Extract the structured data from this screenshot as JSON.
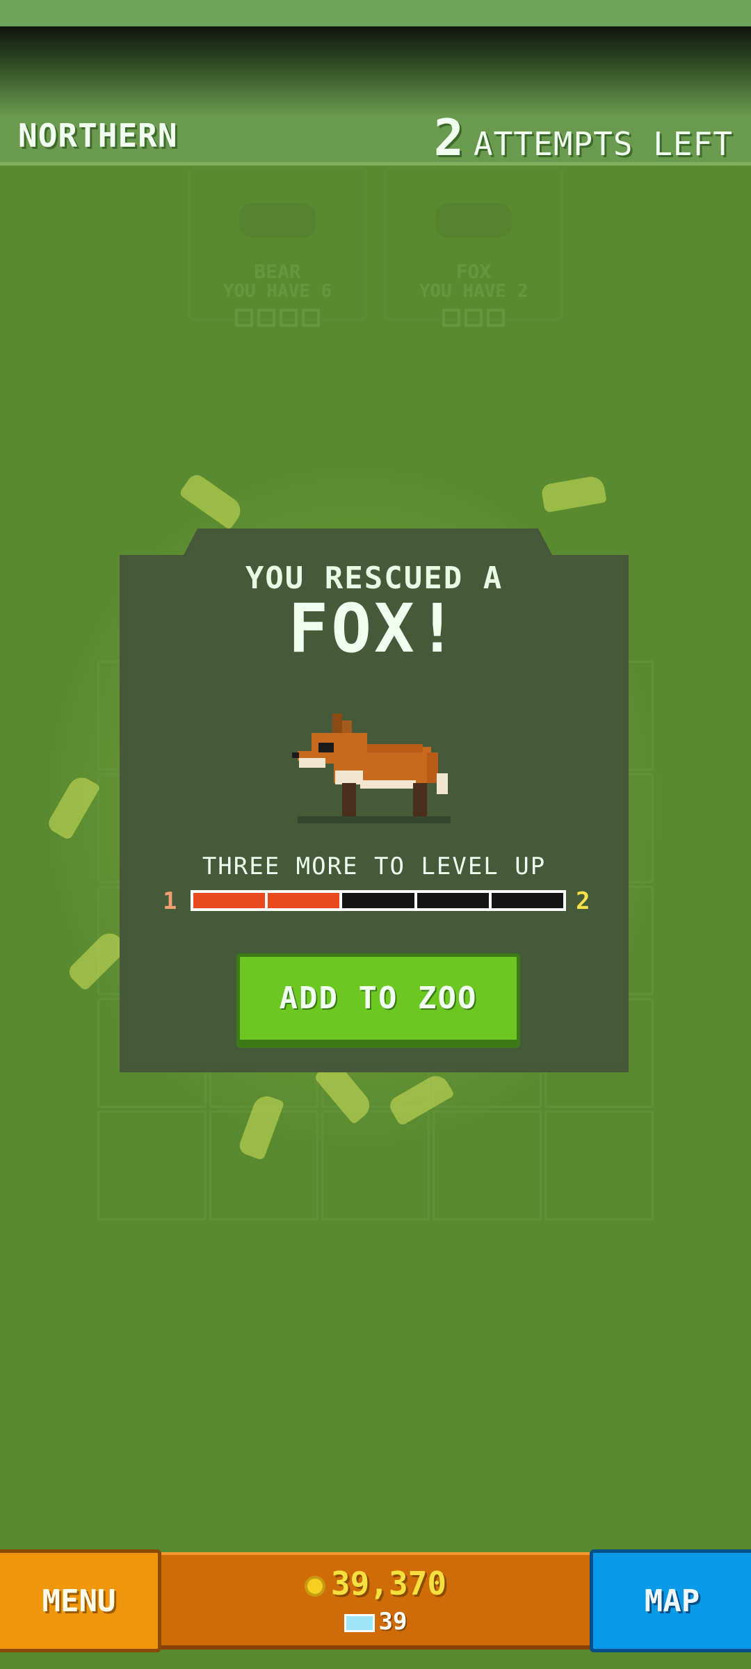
{
  "header": {
    "region": "NORTHERN",
    "attempts_count": "2",
    "attempts_label": "ATTEMPTS LEFT"
  },
  "background_cards": [
    {
      "name": "BEAR",
      "have": "YOU HAVE 6",
      "slots": 4
    },
    {
      "name": "FOX",
      "have": "YOU HAVE 2",
      "slots": 3
    }
  ],
  "modal": {
    "heading": "YOU RESCUED A",
    "animal": "FOX!",
    "level_text": "THREE MORE TO LEVEL UP",
    "level_from": "1",
    "level_to": "2",
    "progress_filled": 2,
    "progress_total": 5,
    "add_button": "ADD TO ZOO"
  },
  "bottom_bar": {
    "menu_label": "MENU",
    "coins": "39,370",
    "gems": "39",
    "map_label": "MAP"
  },
  "icons": [
    "coin-icon",
    "gem-icon",
    "fox-sprite"
  ]
}
